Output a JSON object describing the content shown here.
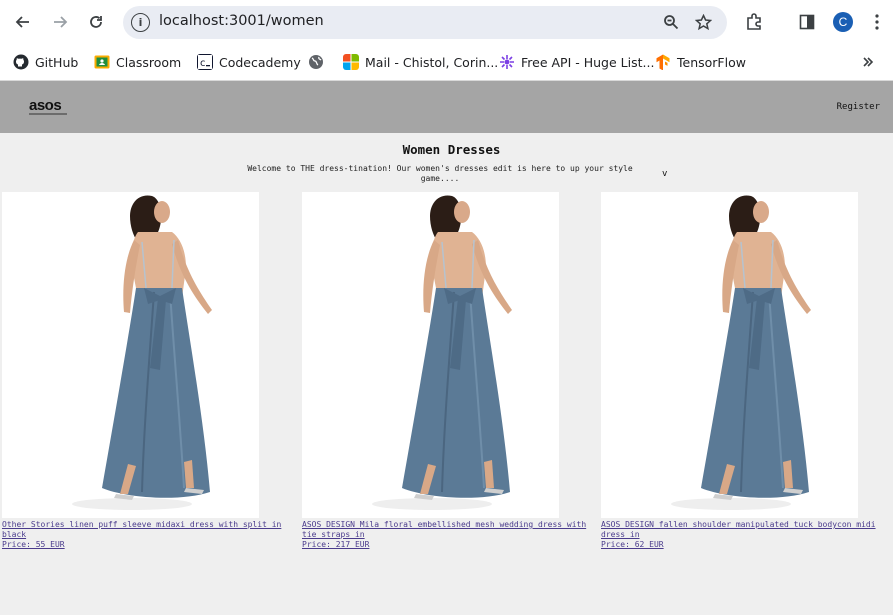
{
  "browser": {
    "url": "localhost:3001/women",
    "avatar_letter": "C",
    "bookmarks": [
      {
        "label": "GitHub",
        "icon": "github-icon",
        "color": "#24292f"
      },
      {
        "label": "Classroom",
        "icon": "classroom-icon",
        "color": "#2e7d32"
      },
      {
        "label": "Codecademy",
        "icon": "codecademy-icon",
        "color": "#10162f"
      },
      {
        "label": "",
        "icon": "globe-icon",
        "color": "#5f6368"
      },
      {
        "label": "Mail - Chistol, Corin...",
        "icon": "microsoft-icon",
        "color": "#f25022"
      },
      {
        "label": "Free API - Huge List...",
        "icon": "api-icon",
        "color": "#7b3fe4"
      },
      {
        "label": "TensorFlow",
        "icon": "tensorflow-icon",
        "color": "#ff8f00"
      }
    ]
  },
  "site": {
    "logo": "asos",
    "register_label": "Register",
    "title": "Women Dresses",
    "description": "Welcome to THE dress-tination! Our women's dresses edit is here to up your style game....",
    "expand_label": "v"
  },
  "products": [
    {
      "name": "Other Stories linen puff sleeve midaxi dress with split in black",
      "price": "Price: 55 EUR"
    },
    {
      "name": "ASOS DESIGN Mila floral embellished mesh wedding dress with tie straps in",
      "price": "Price: 217 EUR"
    },
    {
      "name": "ASOS DESIGN fallen shoulder manipulated tuck bodycon midi dress in",
      "price": "Price: 62 EUR"
    }
  ],
  "colors": {
    "header_bg": "#a5a5a5",
    "page_bg": "#efefef",
    "link": "#4a3b8c",
    "dress": "#5b7a96"
  }
}
